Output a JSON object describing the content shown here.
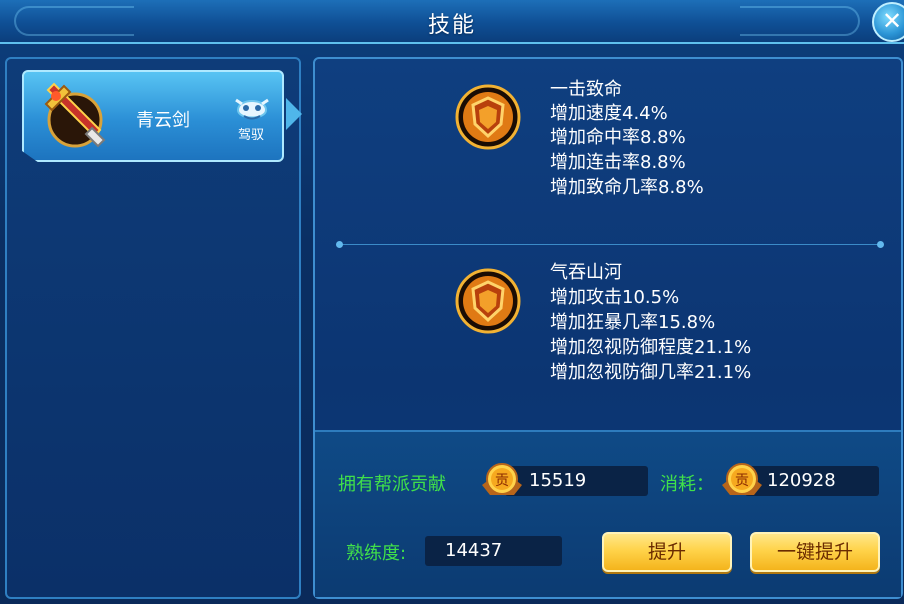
{
  "window": {
    "title": "技能"
  },
  "left_list": {
    "items": [
      {
        "name": "青云剑",
        "tag": "驾驭"
      }
    ]
  },
  "skills": [
    {
      "name": "一击致命",
      "effects": [
        "增加速度4.4%",
        "增加命中率8.8%",
        "增加连击率8.8%",
        "增加致命几率8.8%"
      ]
    },
    {
      "name": "气吞山河",
      "effects": [
        "增加攻击10.5%",
        "增加狂暴几率15.8%",
        "增加忽视防御程度21.1%",
        "增加忽视防御几率21.1%"
      ]
    }
  ],
  "resources": {
    "contribution_label": "拥有帮派贡献",
    "contribution_value": "15519",
    "cost_label": "消耗：",
    "cost_value": "120928",
    "coin_glyph": "贡",
    "proficiency_label": "熟练度:",
    "proficiency_value": "14437"
  },
  "buttons": {
    "upgrade": "提升",
    "upgrade_all": "一键提升"
  },
  "colors": {
    "accent_green": "#40e04a",
    "button_gold": "#ffd34a",
    "panel_blue": "#0c3572"
  },
  "icons": {
    "close": "close-icon",
    "weapon": "sword-icon",
    "mount": "beast-head-icon",
    "skill": "shield-emblem-icon",
    "coin": "coin-icon"
  }
}
